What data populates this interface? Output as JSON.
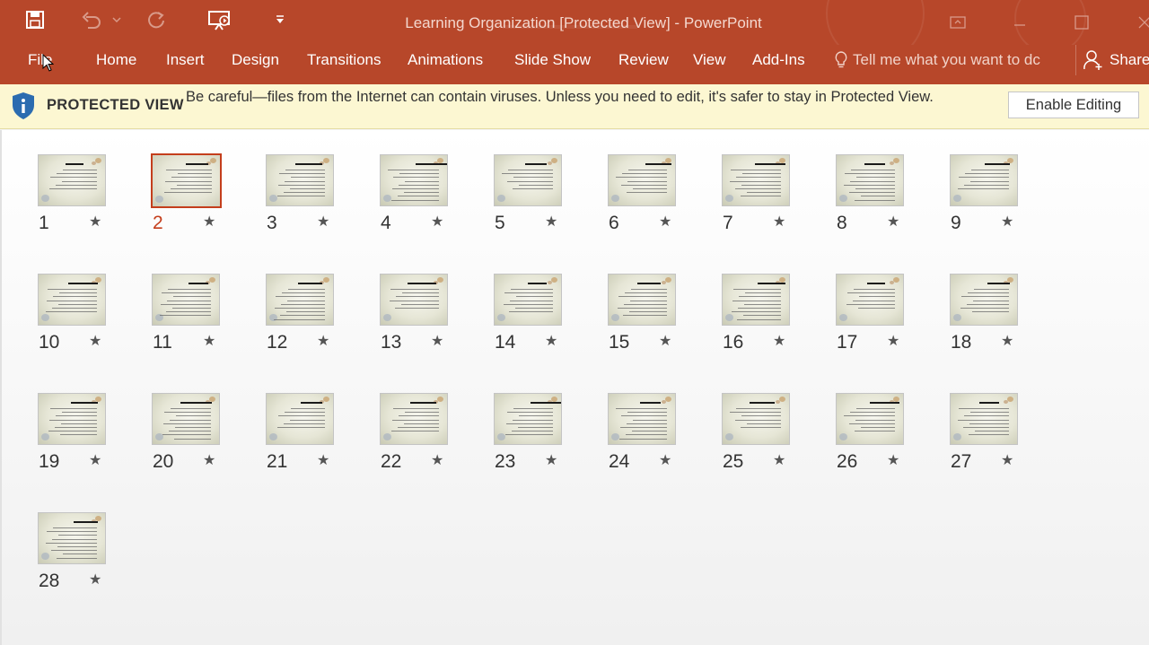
{
  "window": {
    "title": "Learning Organization [Protected View] - PowerPoint",
    "accent_color": "#b7472a"
  },
  "qat": {
    "icons": [
      "save-icon",
      "undo-icon",
      "redo-icon",
      "present-from-beginning-icon",
      "customize-qat-icon"
    ]
  },
  "ribbon": {
    "tabs": [
      "File",
      "Home",
      "Insert",
      "Design",
      "Transitions",
      "Animations",
      "Slide Show",
      "Review",
      "View",
      "Add-Ins"
    ],
    "tell_me": "Tell me what you want to dc",
    "share": "Share"
  },
  "protected_view": {
    "title": "PROTECTED VIEW",
    "message": "Be careful—files from the Internet can contain viruses. Unless you need to edit, it's safer to stay in Protected View.",
    "button": "Enable Editing"
  },
  "sorter": {
    "selected": "2",
    "slides": [
      "1",
      "2",
      "3",
      "4",
      "5",
      "6",
      "7",
      "8",
      "9",
      "10",
      "11",
      "12",
      "13",
      "14",
      "15",
      "16",
      "17",
      "18",
      "19",
      "20",
      "21",
      "22",
      "23",
      "24",
      "25",
      "26",
      "27",
      "28"
    ],
    "star_glyph": "★"
  }
}
